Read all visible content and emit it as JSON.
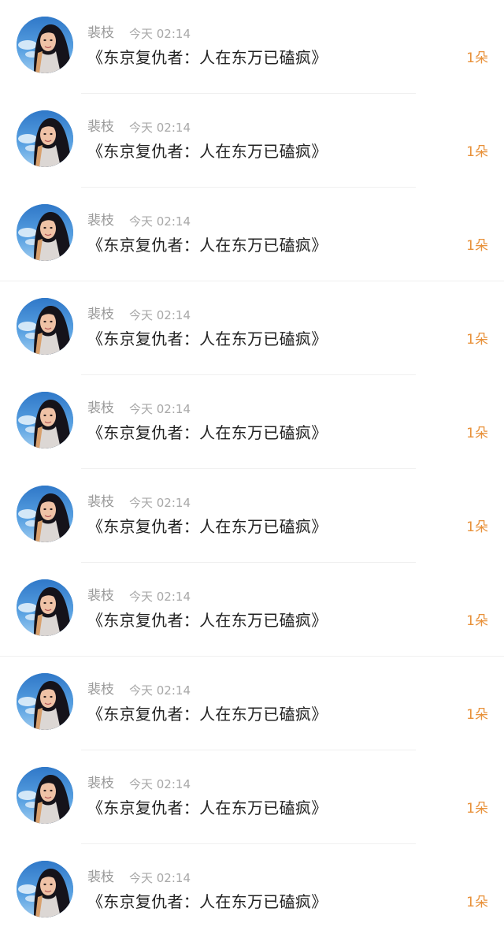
{
  "colors": {
    "name": "#9a9a9a",
    "time": "#a8a8a8",
    "message": "#222222",
    "amount": "#e8913a",
    "divider": "#f0f0f0"
  },
  "gifts": [
    {
      "name": "裴枝",
      "time": "今天 02:14",
      "message": "《东京复仇者：人在东万已磕疯》",
      "amount": "1朵"
    },
    {
      "name": "裴枝",
      "time": "今天 02:14",
      "message": "《东京复仇者：人在东万已磕疯》",
      "amount": "1朵"
    },
    {
      "name": "裴枝",
      "time": "今天 02:14",
      "message": "《东京复仇者：人在东万已磕疯》",
      "amount": "1朵"
    },
    {
      "name": "裴枝",
      "time": "今天 02:14",
      "message": "《东京复仇者：人在东万已磕疯》",
      "amount": "1朵"
    },
    {
      "name": "裴枝",
      "time": "今天 02:14",
      "message": "《东京复仇者：人在东万已磕疯》",
      "amount": "1朵"
    },
    {
      "name": "裴枝",
      "time": "今天 02:14",
      "message": "《东京复仇者：人在东万已磕疯》",
      "amount": "1朵"
    },
    {
      "name": "裴枝",
      "time": "今天 02:14",
      "message": "《东京复仇者：人在东万已磕疯》",
      "amount": "1朵"
    },
    {
      "name": "裴枝",
      "time": "今天 02:14",
      "message": "《东京复仇者：人在东万已磕疯》",
      "amount": "1朵"
    },
    {
      "name": "裴枝",
      "time": "今天 02:14",
      "message": "《东京复仇者：人在东万已磕疯》",
      "amount": "1朵"
    },
    {
      "name": "裴枝",
      "time": "今天 02:14",
      "message": "《东京复仇者：人在东万已磕疯》",
      "amount": "1朵"
    }
  ]
}
